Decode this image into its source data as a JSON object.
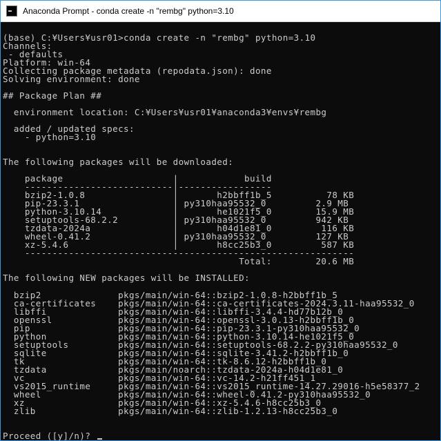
{
  "window": {
    "title": "Anaconda Prompt - conda  create -n \"rembg\" python=3.10"
  },
  "console": {
    "lines": [
      "",
      "(base) C:¥Users¥usr01>conda create -n \"rembg\" python=3.10",
      "Channels:",
      " - defaults",
      "Platform: win-64",
      "Collecting package metadata (repodata.json): done",
      "Solving environment: done",
      "",
      "## Package Plan ##",
      "",
      "  environment location: C:¥Users¥usr01¥anaconda3¥envs¥rembg",
      "",
      "  added / updated specs:",
      "    - python=3.10",
      "",
      "",
      "The following packages will be downloaded:",
      "",
      "    package                    |            build",
      "    ---------------------------|-----------------",
      "    bzip2-1.0.8                |       h2bbff1b_5          78 KB",
      "    pip-23.3.1                 | py310haa95532_0         2.9 MB",
      "    python-3.10.14             |       he1021f5_0        15.9 MB",
      "    setuptools-68.2.2          | py310haa95532_0         942 KB",
      "    tzdata-2024a               |       h04d1e81_0         116 KB",
      "    wheel-0.41.2               | py310haa95532_0         127 KB",
      "    xz-5.4.6                   |       h8cc25b3_0         587 KB",
      "    ------------------------------------------------------------",
      "                                           Total:        20.6 MB",
      "",
      "The following NEW packages will be INSTALLED:",
      "",
      "  bzip2              pkgs/main/win-64::bzip2-1.0.8-h2bbff1b_5",
      "  ca-certificates    pkgs/main/win-64::ca-certificates-2024.3.11-haa95532_0",
      "  libffi             pkgs/main/win-64::libffi-3.4.4-hd77b12b_0",
      "  openssl            pkgs/main/win-64::openssl-3.0.13-h2bbff1b_0",
      "  pip                pkgs/main/win-64::pip-23.3.1-py310haa95532_0",
      "  python             pkgs/main/win-64::python-3.10.14-he1021f5_0",
      "  setuptools         pkgs/main/win-64::setuptools-68.2.2-py310haa95532_0",
      "  sqlite             pkgs/main/win-64::sqlite-3.41.2-h2bbff1b_0",
      "  tk                 pkgs/main/win-64::tk-8.6.12-h2bbff1b_0",
      "  tzdata             pkgs/main/noarch::tzdata-2024a-h04d1e81_0",
      "  vc                 pkgs/main/win-64::vc-14.2-h21ff451_1",
      "  vs2015_runtime     pkgs/main/win-64::vs2015_runtime-14.27.29016-h5e58377_2",
      "  wheel              pkgs/main/win-64::wheel-0.41.2-py310haa95532_0",
      "  xz                 pkgs/main/win-64::xz-5.4.6-h8cc25b3_0",
      "  zlib               pkgs/main/win-64::zlib-1.2.13-h8cc25b3_0",
      "",
      "",
      "Proceed ([y]/n)? "
    ]
  },
  "colors": {
    "background": "#0c0c0c",
    "foreground": "#cccccc",
    "titlebar": "#ffffff",
    "window_border": "#3a96dd"
  },
  "icons": {
    "app": "console-icon",
    "cursor": "text-cursor"
  }
}
